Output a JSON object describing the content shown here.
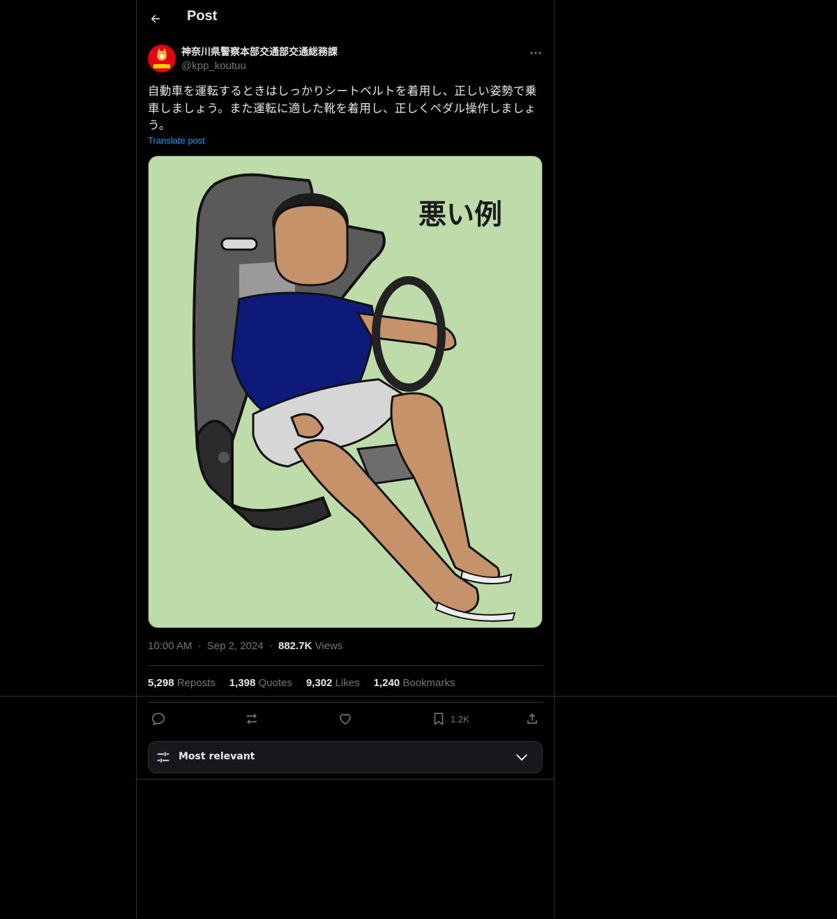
{
  "header": {
    "title": "Post"
  },
  "author": {
    "name": "神奈川県警察本部交通部交通総務課",
    "handle": "@kpp_koutuu"
  },
  "post": {
    "text": "自動車を運転するときはしっかりシートベルトを着用し、正しい姿勢で乗車しましょう。また運転に適した靴を着用し、正しくペダル操作しましょう。",
    "translate_label": "Translate post",
    "media_caption": "悪い例"
  },
  "meta": {
    "time": "10:00 AM",
    "sep": "·",
    "date": "Sep 2, 2024",
    "views_count": "882.7K",
    "views_label": "Views"
  },
  "stats": [
    {
      "count": "5,298",
      "label": "Reposts"
    },
    {
      "count": "1,398",
      "label": "Quotes"
    },
    {
      "count": "9,302",
      "label": "Likes"
    },
    {
      "count": "1,240",
      "label": "Bookmarks"
    }
  ],
  "actions": {
    "bookmark_count": "1.2K"
  },
  "sort": {
    "label": "Most relevant"
  },
  "colors": {
    "background": "#000000",
    "accent": "#1d9bf0",
    "border": "#2f3336",
    "muted": "#71767b",
    "media_bg": "#bddcaa"
  }
}
